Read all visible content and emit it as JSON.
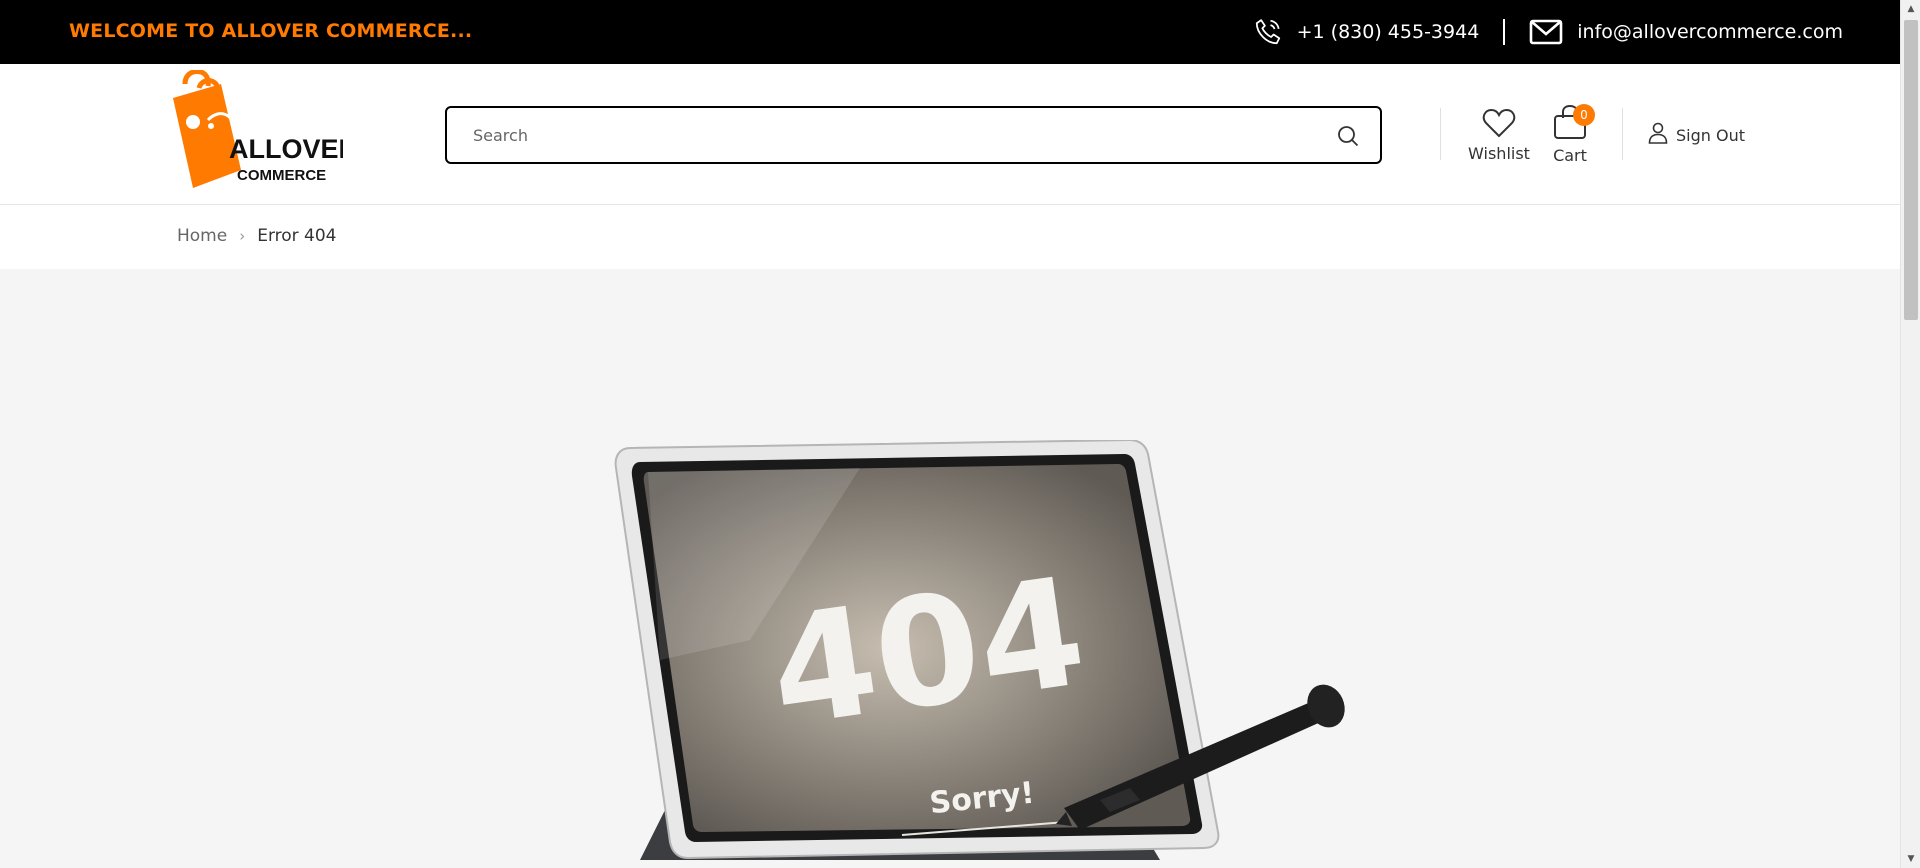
{
  "topbar": {
    "welcome": "WELCOME TO ALLOVER COMMERCE...",
    "phone": "+1 (830) 455-3944",
    "email": "info@allovercommerce.com",
    "phone_icon": "phone-icon",
    "email_icon": "envelope-icon"
  },
  "brand": {
    "line1": "ALLOVER",
    "line2": "COMMERCE",
    "accent": "#ff7a00"
  },
  "search": {
    "placeholder": "Search",
    "icon": "search-icon"
  },
  "header": {
    "wishlist_label": "Wishlist",
    "cart_label": "Cart",
    "cart_count": "0",
    "signout_label": "Sign Out"
  },
  "breadcrumb": {
    "home": "Home",
    "separator": "›",
    "current": "Error 404"
  },
  "hero": {
    "big_text": "404",
    "sub_text": "Sorry!"
  }
}
